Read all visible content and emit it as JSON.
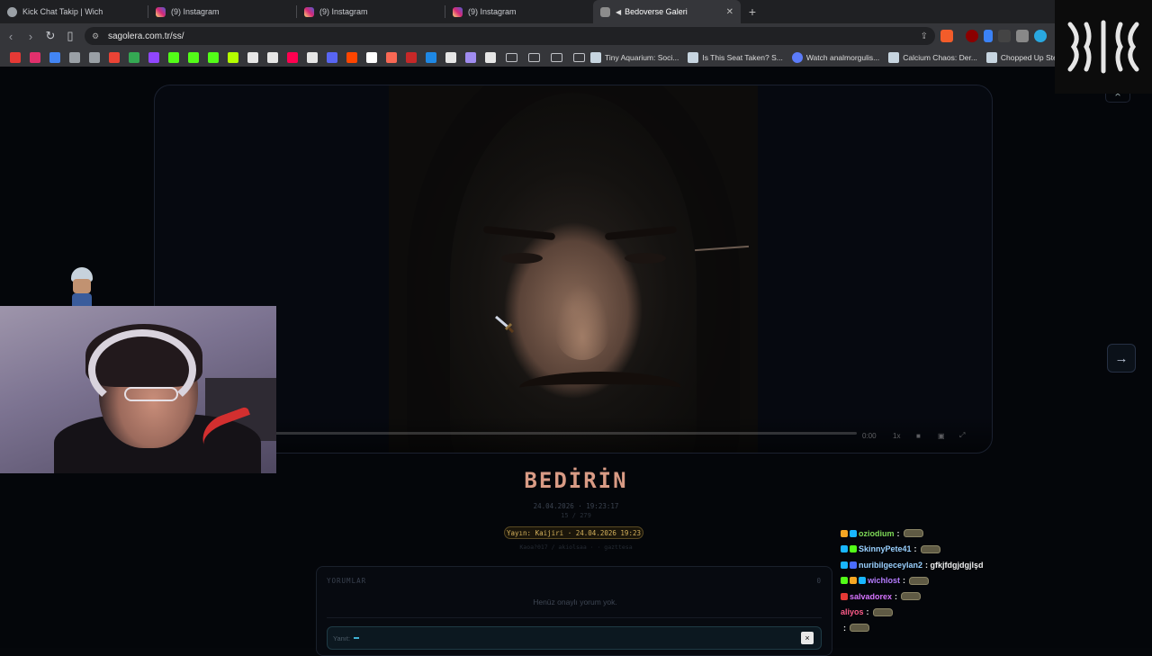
{
  "browser": {
    "tabs": [
      {
        "label": "Kick Chat Takip | Wich",
        "icon": "globe-icon",
        "color": "#9aa0a6"
      },
      {
        "label": "(9) Instagram",
        "icon": "instagram-icon",
        "color": "#e1306c"
      },
      {
        "label": "(9) Instagram",
        "icon": "instagram-icon",
        "color": "#e1306c"
      },
      {
        "label": "(9) Instagram",
        "icon": "instagram-icon",
        "color": "#e1306c"
      },
      {
        "label": "Bedoverse Galeri",
        "icon": "gallery-icon",
        "color": "#8c8c8c",
        "active": true
      }
    ],
    "url": "sagolera.com.tr/ss/",
    "bookmark_folders": 4,
    "bookmarks": [
      {
        "label": "Tiny Aquarium: Soci...",
        "icon": "steam-icon"
      },
      {
        "label": "Is This Seat Taken? S...",
        "icon": "steam-icon"
      },
      {
        "label": "Watch analmorgulis...",
        "icon": "stream-icon"
      },
      {
        "label": "Calcium Chaos: Der...",
        "icon": "steam-icon"
      },
      {
        "label": "Chopped Up Steam",
        "icon": "steam-icon"
      }
    ],
    "bookmark_icon_colors": [
      "#e53935",
      "#e1306c",
      "#4285f4",
      "#9aa0a6",
      "#9aa0a6",
      "#ea4335",
      "#34a853",
      "#9146ff",
      "#53fc18",
      "#53fc18",
      "#53fc18",
      "#b3ff00",
      "#e6e6e6",
      "#e6e6e6",
      "#ff0050",
      "#e6e6e6",
      "#5865f2",
      "#ff4500",
      "#ffffff",
      "#f96854",
      "#c62828",
      "#1e88e5",
      "#e6e6e6",
      "#a08cf0",
      "#e6e6e6"
    ]
  },
  "viewer": {
    "title": "BEDİRİN",
    "datetime": "24.04.2026 · 19:23:17",
    "index": "15 / 279",
    "publish_badge": "Yayın: Kaijiri · 24.04.2026 19:23",
    "tags": "Kaoa?017 / akiolsaa · · gazttesa",
    "close_label": "×",
    "next_label": "→",
    "video_controls": [
      "0:00",
      "1x",
      "vol-icon",
      "pip-icon",
      "fullscreen-icon"
    ]
  },
  "comments": {
    "header": "YORUMLAR",
    "count": "0",
    "empty_text": "Henüz onaylı yorum yok.",
    "reply_placeholder": "Yanıt:",
    "reply_close": "×"
  },
  "chat": [
    {
      "user": "oziodium",
      "color": "#7ed957",
      "msg": ":",
      "emote": true,
      "badges": [
        "#f5a623",
        "#19b6ff"
      ]
    },
    {
      "user": "SkinnyPete41",
      "color": "#9ad1ff",
      "msg": ":",
      "emote": true,
      "badges": [
        "#19b6ff",
        "#53fc18"
      ]
    },
    {
      "user": "nuribilgeceylan2",
      "color": "#9ad1ff",
      "msg": ": gfkjfdgjdgjlşd",
      "emote": false,
      "badges": [
        "#19b6ff",
        "#4a6cff"
      ]
    },
    {
      "user": "wichlost",
      "color": "#b57cff",
      "msg": ":",
      "emote": true,
      "badges": [
        "#53fc18",
        "#f5a623",
        "#19b6ff"
      ]
    },
    {
      "user": "salvadorex",
      "color": "#d774ff",
      "msg": ":",
      "emote": true,
      "badges": [
        "#e53935"
      ]
    },
    {
      "user": "aliyos",
      "color": "#ff5c8a",
      "msg": ":",
      "emote": true,
      "badges": []
    },
    {
      "user": "",
      "color": "#ffffff",
      "msg": ":",
      "emote": true,
      "badges": []
    }
  ]
}
